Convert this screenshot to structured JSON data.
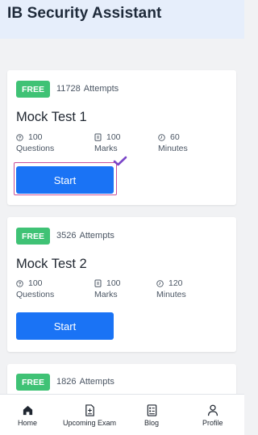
{
  "header": {
    "title": "IB Security Assistant"
  },
  "cards": [
    {
      "badge": "FREE",
      "attempts_count": "11728",
      "attempts_label": "Attempts",
      "title": "Mock Test 1",
      "questions_value": "100",
      "questions_label": "Questions",
      "marks_value": "100",
      "marks_label": "Marks",
      "minutes_value": "60",
      "minutes_label": "Minutes",
      "start_label": "Start"
    },
    {
      "badge": "FREE",
      "attempts_count": "3526",
      "attempts_label": "Attempts",
      "title": "Mock Test 2",
      "questions_value": "100",
      "questions_label": "Questions",
      "marks_value": "100",
      "marks_label": "Marks",
      "minutes_value": "120",
      "minutes_label": "Minutes",
      "start_label": "Start"
    },
    {
      "badge": "FREE",
      "attempts_count": "1826",
      "attempts_label": "Attempts"
    }
  ],
  "bottom_nav": {
    "items": [
      {
        "label": "Home",
        "icon": "home-icon"
      },
      {
        "label": "Upcoming Exam",
        "icon": "exam-icon"
      },
      {
        "label": "Blog",
        "icon": "blog-icon"
      },
      {
        "label": "Profile",
        "icon": "profile-icon"
      }
    ]
  },
  "colors": {
    "accent": "#1a73f5",
    "badge": "#3fc275",
    "header_bg": "#e6eefb",
    "highlight": "#c9519a",
    "check": "#7a45c8"
  }
}
